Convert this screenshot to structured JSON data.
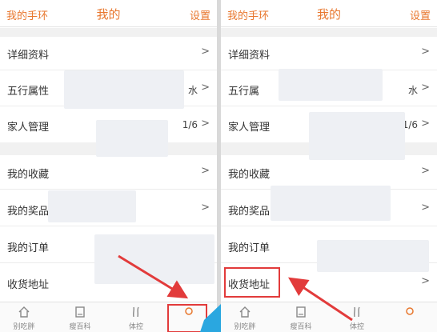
{
  "colors": {
    "accent": "#e8772e",
    "annotation": "#e23b3b",
    "text": "#333333"
  },
  "left": {
    "header": {
      "left": "我的手环",
      "title": "我的",
      "right": "设置"
    },
    "rows": [
      {
        "label": "详细资料",
        "value": "",
        "chevron": ">"
      },
      {
        "label": "五行属性",
        "value": "水",
        "chevron": ">"
      },
      {
        "label": "家人管理",
        "value": "1/6",
        "chevron": ">"
      },
      {
        "label": "我的收藏",
        "value": "",
        "chevron": ">"
      },
      {
        "label": "我的奖品",
        "value": "",
        "chevron": ">"
      },
      {
        "label": "我的订单",
        "value": "",
        "chevron": ">"
      },
      {
        "label": "收货地址",
        "value": "",
        "chevron": ">"
      }
    ],
    "tabs": [
      {
        "label": "别吃胖",
        "icon": "home-icon"
      },
      {
        "label": "瘦百科",
        "icon": "book-icon"
      },
      {
        "label": "体控",
        "icon": "leaf-icon"
      },
      {
        "label": "",
        "icon": "profile-icon"
      }
    ]
  },
  "right": {
    "header": {
      "left": "我的手环",
      "title": "我的",
      "right": "设置"
    },
    "rows": [
      {
        "label": "详细资料",
        "value": "",
        "chevron": ">"
      },
      {
        "label": "五行属",
        "value": "水",
        "chevron": ">"
      },
      {
        "label": "家人管理",
        "value": "1/6",
        "chevron": ">"
      },
      {
        "label": "我的收藏",
        "value": "",
        "chevron": ">"
      },
      {
        "label": "我的奖品",
        "value": "",
        "chevron": ">"
      },
      {
        "label": "我的订单",
        "value": "",
        "chevron": ">"
      },
      {
        "label": "收货地址",
        "value": "",
        "chevron": ">"
      }
    ],
    "tabs": [
      {
        "label": "别吃胖",
        "icon": "home-icon"
      },
      {
        "label": "瘦百科",
        "icon": "book-icon"
      },
      {
        "label": "体控",
        "icon": "leaf-icon"
      },
      {
        "label": "",
        "icon": "profile-icon"
      }
    ]
  }
}
